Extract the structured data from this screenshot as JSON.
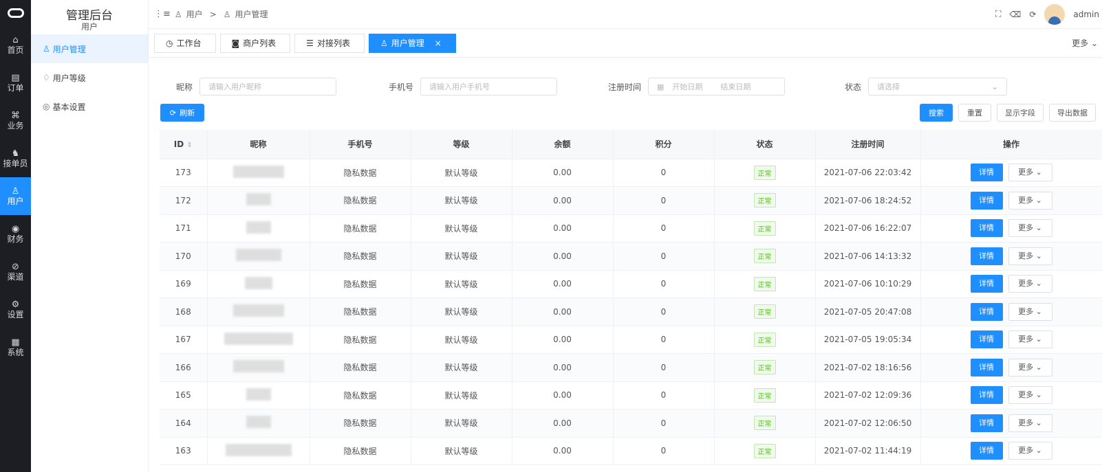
{
  "rail": {
    "items": [
      {
        "icon": "home-icon",
        "glyph": "⌂",
        "label": "首页"
      },
      {
        "icon": "order-icon",
        "glyph": "▤",
        "label": "订单"
      },
      {
        "icon": "business-icon",
        "glyph": "⌘",
        "label": "业务"
      },
      {
        "icon": "rider-icon",
        "glyph": "♞",
        "label": "接单员"
      },
      {
        "icon": "user-icon",
        "glyph": "♙",
        "label": "用户"
      },
      {
        "icon": "finance-icon",
        "glyph": "◉",
        "label": "财务"
      },
      {
        "icon": "channel-icon",
        "glyph": "⊘",
        "label": "渠道"
      },
      {
        "icon": "settings-icon",
        "glyph": "⚙",
        "label": "设置"
      },
      {
        "icon": "system-icon",
        "glyph": "▦",
        "label": "系统"
      }
    ],
    "active_index": 4
  },
  "menu": {
    "title": "管理后台",
    "subtitle": "用户",
    "items": [
      {
        "icon": "user-icon",
        "glyph": "♙",
        "label": "用户管理"
      },
      {
        "icon": "diamond-icon",
        "glyph": "♢",
        "label": "用户等级"
      },
      {
        "icon": "gear-icon",
        "glyph": "◎",
        "label": "基本设置"
      }
    ]
  },
  "breadcrumb": {
    "items": [
      "用户",
      "用户管理"
    ],
    "separator": ">"
  },
  "header": {
    "username": "admin"
  },
  "tabs": {
    "items": [
      {
        "icon": "dashboard-icon",
        "glyph": "◷",
        "label": "工作台"
      },
      {
        "icon": "merchant-icon",
        "glyph": "◙",
        "label": "商户列表"
      },
      {
        "icon": "list-icon",
        "glyph": "☰",
        "label": "对接列表"
      },
      {
        "icon": "user-icon",
        "glyph": "♙",
        "label": "用户管理"
      }
    ],
    "more": "更多"
  },
  "filters": {
    "nickname_label": "昵称",
    "nickname_placeholder": "请输入用户昵称",
    "phone_label": "手机号",
    "phone_placeholder": "请输入用户手机号",
    "regtime_label": "注册时间",
    "start_placeholder": "开始日期",
    "end_placeholder": "结束日期",
    "status_label": "状态",
    "status_placeholder": "请选择"
  },
  "buttons": {
    "refresh": "刷新",
    "search": "搜索",
    "reset": "重置",
    "show_fields": "显示字段",
    "export": "导出数据"
  },
  "table": {
    "columns": [
      "ID",
      "昵称",
      "手机号",
      "等级",
      "余额",
      "积分",
      "状态",
      "注册时间",
      "操作"
    ],
    "detail_label": "详情",
    "more_label": "更多",
    "rows": [
      {
        "id": "173",
        "phone": "隐私数据",
        "level": "默认等级",
        "balance": "0.00",
        "points": "0",
        "status": "正常",
        "time": "2021-07-06 22:03:42"
      },
      {
        "id": "172",
        "phone": "隐私数据",
        "level": "默认等级",
        "balance": "0.00",
        "points": "0",
        "status": "正常",
        "time": "2021-07-06 18:24:52"
      },
      {
        "id": "171",
        "phone": "隐私数据",
        "level": "默认等级",
        "balance": "0.00",
        "points": "0",
        "status": "正常",
        "time": "2021-07-06 16:22:07"
      },
      {
        "id": "170",
        "phone": "隐私数据",
        "level": "默认等级",
        "balance": "0.00",
        "points": "0",
        "status": "正常",
        "time": "2021-07-06 14:13:32"
      },
      {
        "id": "169",
        "phone": "隐私数据",
        "level": "默认等级",
        "balance": "0.00",
        "points": "0",
        "status": "正常",
        "time": "2021-07-06 10:10:29"
      },
      {
        "id": "168",
        "phone": "隐私数据",
        "level": "默认等级",
        "balance": "0.00",
        "points": "0",
        "status": "正常",
        "time": "2021-07-05 20:47:08"
      },
      {
        "id": "167",
        "phone": "隐私数据",
        "level": "默认等级",
        "balance": "0.00",
        "points": "0",
        "status": "正常",
        "time": "2021-07-05 19:05:34"
      },
      {
        "id": "166",
        "phone": "隐私数据",
        "level": "默认等级",
        "balance": "0.00",
        "points": "0",
        "status": "正常",
        "time": "2021-07-02 18:16:56"
      },
      {
        "id": "165",
        "phone": "隐私数据",
        "level": "默认等级",
        "balance": "0.00",
        "points": "0",
        "status": "正常",
        "time": "2021-07-02 12:09:36"
      },
      {
        "id": "164",
        "phone": "隐私数据",
        "level": "默认等级",
        "balance": "0.00",
        "points": "0",
        "status": "正常",
        "time": "2021-07-02 12:06:50"
      },
      {
        "id": "163",
        "phone": "隐私数据",
        "level": "默认等级",
        "balance": "0.00",
        "points": "0",
        "status": "正常",
        "time": "2021-07-02 11:44:19"
      }
    ]
  },
  "colors": {
    "primary": "#1f8fff",
    "rail_bg": "#1d1e23",
    "success": "#52c41a"
  }
}
